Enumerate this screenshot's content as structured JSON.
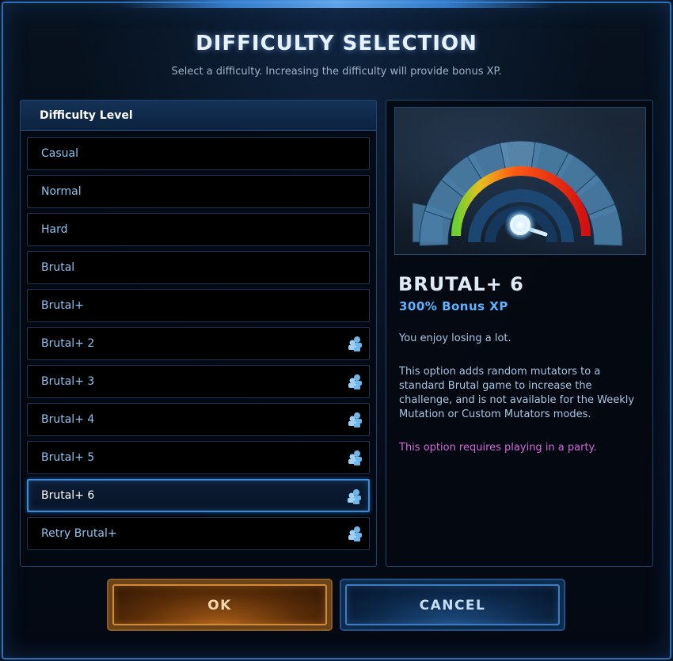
{
  "dialog": {
    "title": "DIFFICULTY SELECTION",
    "subtitle": "Select a difficulty.  Increasing the difficulty will provide bonus XP."
  },
  "difficulty_list": {
    "header": "Difficulty Level",
    "items": [
      {
        "label": "Casual",
        "party_required": false,
        "selected": false
      },
      {
        "label": "Normal",
        "party_required": false,
        "selected": false
      },
      {
        "label": "Hard",
        "party_required": false,
        "selected": false
      },
      {
        "label": "Brutal",
        "party_required": false,
        "selected": false
      },
      {
        "label": "Brutal+",
        "party_required": false,
        "selected": false
      },
      {
        "label": "Brutal+ 2",
        "party_required": true,
        "selected": false
      },
      {
        "label": "Brutal+ 3",
        "party_required": true,
        "selected": false
      },
      {
        "label": "Brutal+ 4",
        "party_required": true,
        "selected": false
      },
      {
        "label": "Brutal+ 5",
        "party_required": true,
        "selected": false
      },
      {
        "label": "Brutal+ 6",
        "party_required": true,
        "selected": true
      },
      {
        "label": "Retry Brutal+",
        "party_required": true,
        "selected": false
      }
    ],
    "party_icon": "party-icon"
  },
  "details": {
    "gauge_icon": "difficulty-gauge",
    "title": "BRUTAL+ 6",
    "bonus": "300% Bonus XP",
    "flavor": "You enjoy losing a lot.",
    "description": "This option adds random mutators to a standard Brutal game to increase the challenge, and is not available for the Weekly Mutation or Custom Mutators modes.",
    "party_note": "This option requires playing in a party."
  },
  "buttons": {
    "ok": "OK",
    "cancel": "CANCEL"
  },
  "colors": {
    "accent_blue": "#3a8bdc",
    "list_text": "#8ec3ee",
    "bonus_text": "#5db4ff",
    "party_note": "#d36ad8",
    "ok_border": "#d08a3a"
  }
}
